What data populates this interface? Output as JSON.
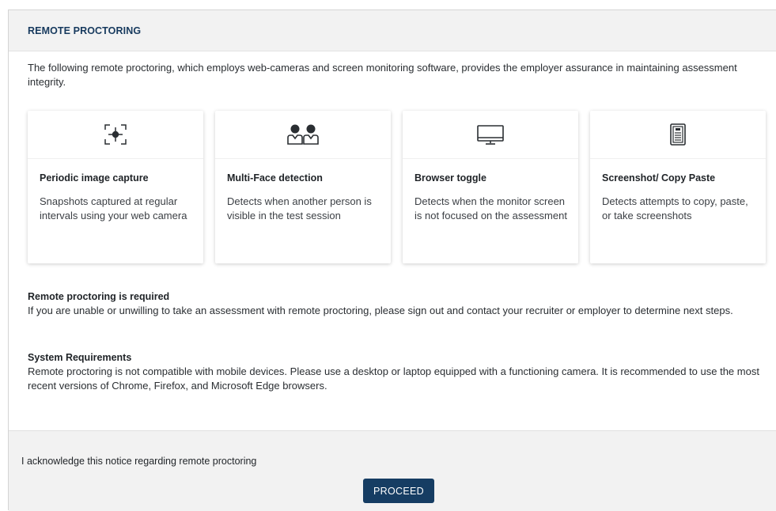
{
  "header": {
    "title": "REMOTE PROCTORING"
  },
  "intro": "The following remote proctoring, which employs web-cameras and screen monitoring software, provides the employer assurance in maintaining assessment integrity.",
  "cards": [
    {
      "icon": "focus-capture-icon",
      "title": "Periodic image capture",
      "description": "Snapshots captured at regular intervals using your web camera"
    },
    {
      "icon": "people-icon",
      "title": "Multi-Face detection",
      "description": "Detects when another person is visible in the test session"
    },
    {
      "icon": "monitor-icon",
      "title": "Browser toggle",
      "description": "Detects when the monitor screen is not focused on the assessment"
    },
    {
      "icon": "document-icon",
      "title": "Screenshot/ Copy Paste",
      "description": "Detects attempts to copy, paste, or take screenshots"
    }
  ],
  "required": {
    "title": "Remote proctoring is required",
    "text": "If you are unable or unwilling to take an assessment with remote proctoring, please sign out and contact your recruiter or employer to determine next steps."
  },
  "system": {
    "title": "System Requirements",
    "text": "Remote proctoring is not compatible with mobile devices. Please use a desktop or laptop equipped with a functioning camera. It is recommended to use the most recent versions of Chrome, Firefox, and Microsoft Edge browsers."
  },
  "footer": {
    "acknowledge": "I acknowledge this notice regarding remote proctoring",
    "proceed_label": "PROCEED"
  },
  "colors": {
    "accent": "#163d63",
    "header_bg": "#f2f2f2",
    "title_blue": "#173a5e"
  }
}
